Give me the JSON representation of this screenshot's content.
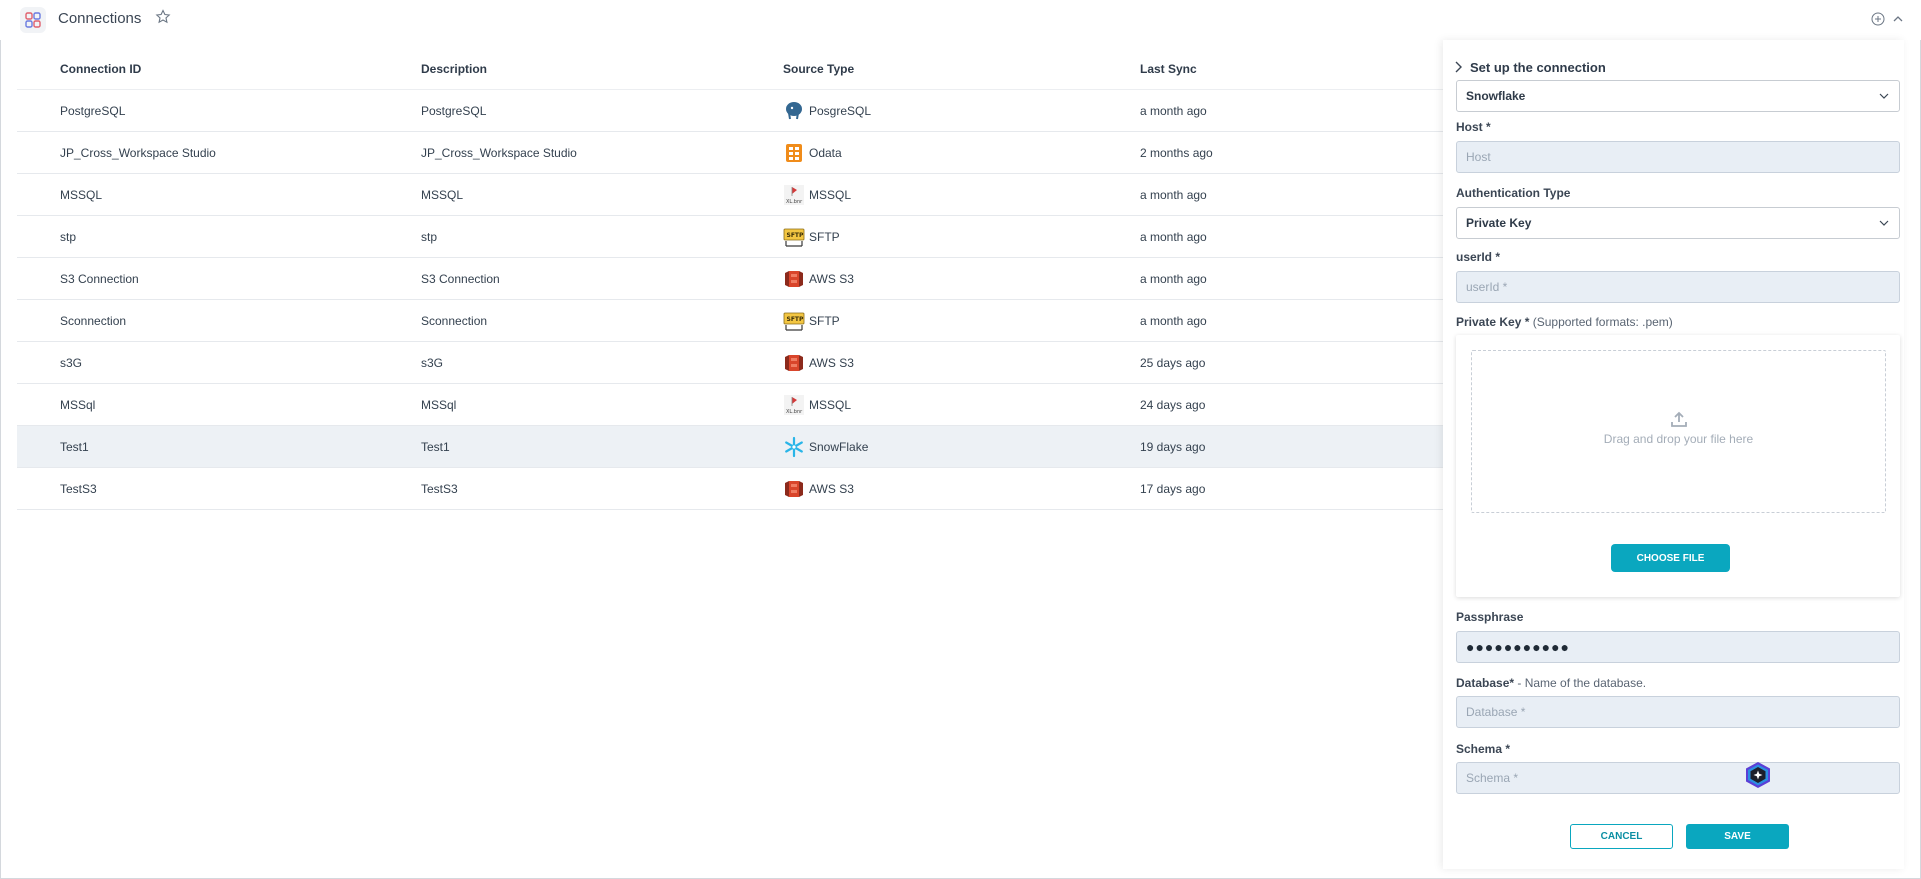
{
  "header": {
    "title": "Connections"
  },
  "table": {
    "columns": [
      "Connection ID",
      "Description",
      "Source Type",
      "Last Sync"
    ],
    "rows": [
      {
        "id": "PostgreSQL",
        "desc": "PostgreSQL",
        "src": "PosgreSQL",
        "icon": "postgres-icon",
        "sync": "a month ago"
      },
      {
        "id": "JP_Cross_Workspace Studio",
        "desc": "JP_Cross_Workspace Studio",
        "src": "Odata",
        "icon": "odata-icon",
        "sync": "2 months ago"
      },
      {
        "id": "MSSQL",
        "desc": "MSSQL",
        "src": "MSSQL",
        "icon": "mssql-icon",
        "sync": "a month ago"
      },
      {
        "id": "stp",
        "desc": "stp",
        "src": "SFTP",
        "icon": "sftp-icon",
        "sync": "a month ago"
      },
      {
        "id": "S3 Connection",
        "desc": "S3 Connection",
        "src": "AWS S3",
        "icon": "aws-s3-icon",
        "sync": "a month ago"
      },
      {
        "id": "Sconnection",
        "desc": "Sconnection",
        "src": "SFTP",
        "icon": "sftp-icon",
        "sync": "a month ago"
      },
      {
        "id": "s3G",
        "desc": "s3G",
        "src": "AWS S3",
        "icon": "aws-s3-icon",
        "sync": "25 days ago"
      },
      {
        "id": "MSSql",
        "desc": "MSSql",
        "src": "MSSQL",
        "icon": "mssql-icon",
        "sync": "24 days ago"
      },
      {
        "id": "Test1",
        "desc": "Test1",
        "src": "SnowFlake",
        "icon": "snowflake-icon",
        "sync": "19 days ago"
      },
      {
        "id": "TestS3",
        "desc": "TestS3",
        "src": "AWS S3",
        "icon": "aws-s3-icon",
        "sync": "17 days ago"
      }
    ]
  },
  "panel": {
    "title": "Set up the connection",
    "source_select": "Snowflake",
    "host_label": "Host *",
    "host_placeholder": "Host",
    "auth_label": "Authentication Type",
    "auth_select": "Private Key",
    "userid_label": "userId *",
    "userid_placeholder": "userId *",
    "pkey_label": "Private Key *",
    "pkey_hint": "(Supported formats: .pem)",
    "drop_text": "Drag and drop your file here",
    "choose_file": "CHOOSE FILE",
    "passphrase_label": "Passphrase",
    "passphrase_value": "●●●●●●●●●●●",
    "database_label": "Database*",
    "database_hint": "- Name of the database.",
    "database_placeholder": "Database *",
    "schema_label": "Schema *",
    "schema_placeholder": "Schema *",
    "cancel": "CANCEL",
    "save": "SAVE"
  },
  "colors": {
    "accent": "#0aa7bf",
    "selected_row": "#edf1f5",
    "input_bg": "#e8eef5"
  }
}
